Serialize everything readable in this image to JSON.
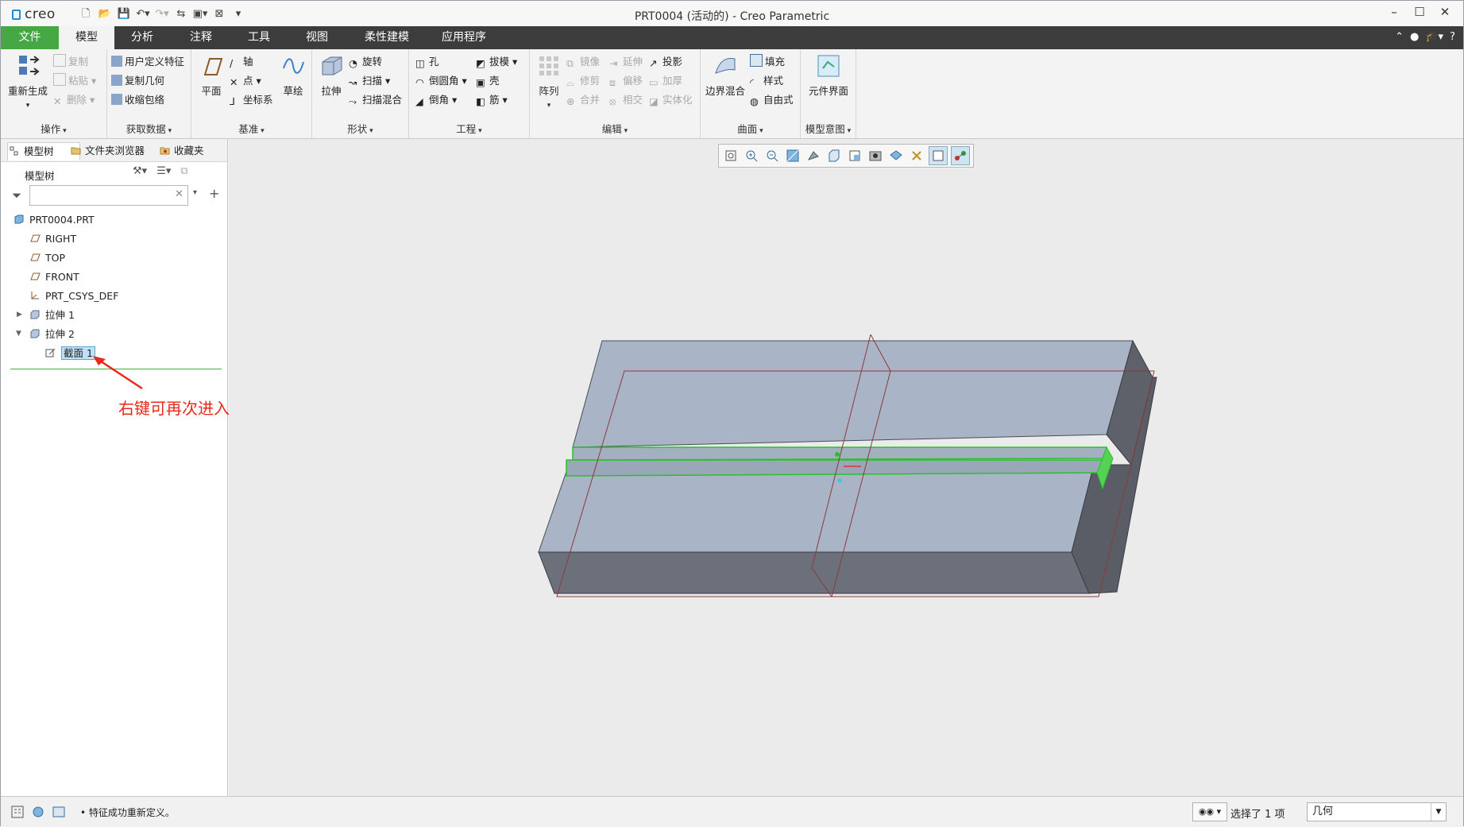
{
  "window": {
    "app_logo": "creo",
    "title": "PRT0004 (活动的) - Creo Parametric",
    "controls": [
      "minimize-icon",
      "maximize-icon",
      "close-icon"
    ]
  },
  "quick_access": [
    "new-icon",
    "open-icon",
    "save-icon",
    "undo-icon",
    "redo-icon",
    "regenerate-icon",
    "windows-icon",
    "close-window-icon",
    "customize-icon"
  ],
  "ribbon_tabs": [
    "文件",
    "模型",
    "分析",
    "注释",
    "工具",
    "视图",
    "柔性建模",
    "应用程序"
  ],
  "active_tab": "模型",
  "ribbon": {
    "ops": {
      "label": "操作",
      "regen": "重新生成",
      "copy": "复制",
      "paste": "粘贴",
      "delete": "删除"
    },
    "getdata": {
      "label": "获取数据",
      "udf": "用户定义特征",
      "copygeom": "复制几何",
      "shrinkwrap": "收缩包络"
    },
    "datum": {
      "label": "基准",
      "plane": "平面",
      "axis": "轴",
      "point": "点",
      "csys": "坐标系",
      "sketch": "草绘"
    },
    "shapes": {
      "label": "形状",
      "extrude": "拉伸",
      "revolve": "旋转",
      "sweep": "扫描",
      "sweptblend": "扫描混合"
    },
    "engineering": {
      "label": "工程",
      "hole": "孔",
      "round": "倒圆角",
      "chamfer": "倒角",
      "draft": "拔模",
      "shell": "壳",
      "rib": "筋"
    },
    "editing": {
      "label": "编辑",
      "pattern": "阵列",
      "mirror": "镜像",
      "trim": "修剪",
      "merge": "合并",
      "extend": "延伸",
      "offset": "偏移",
      "intersect": "相交",
      "project": "投影",
      "thicken": "加厚",
      "solidify": "实体化"
    },
    "surfaces": {
      "label": "曲面",
      "boundary": "边界混合",
      "fill": "填充",
      "style": "样式",
      "freestyle": "自由式"
    },
    "intent": {
      "label": "模型意图",
      "component_interface": "元件界面"
    }
  },
  "navigator": {
    "tabs": [
      "模型树",
      "文件夹浏览器",
      "收藏夹"
    ],
    "tree_header": "模型树",
    "filter_placeholder": "",
    "items": [
      {
        "label": "PRT0004.PRT",
        "icon": "part-icon"
      },
      {
        "label": "RIGHT",
        "icon": "datum-plane-icon"
      },
      {
        "label": "TOP",
        "icon": "datum-plane-icon"
      },
      {
        "label": "FRONT",
        "icon": "datum-plane-icon"
      },
      {
        "label": "PRT_CSYS_DEF",
        "icon": "csys-icon"
      },
      {
        "label": "拉伸 1",
        "icon": "extrude-feature-icon",
        "expanded": false
      },
      {
        "label": "拉伸 2",
        "icon": "extrude-feature-icon",
        "expanded": true
      },
      {
        "label": "截面 1",
        "icon": "sketch-icon",
        "selected": true
      }
    ]
  },
  "annotation": "右键可再次进入草图编辑界面",
  "annotation_color": "#e8291c",
  "view_toolbar": [
    "refit-icon",
    "zoom-in-icon",
    "zoom-out-icon",
    "repaint-icon",
    "display-style-icon",
    "saved-orientations-icon",
    "view-manager-icon",
    "perspective-icon",
    "datum-display-icon",
    "spin-center-icon",
    "annotation-display-icon",
    "ring-icon"
  ],
  "status": {
    "message": "特征成功重新定义。",
    "selection": "选择了 1 项",
    "filter_value": "几何"
  },
  "colors": {
    "file_tab": "#46a844",
    "tabbar": "#3c3c3c",
    "model_face": "#a9b5c6",
    "model_dark": "#6c707a",
    "highlight": "#27c227"
  }
}
